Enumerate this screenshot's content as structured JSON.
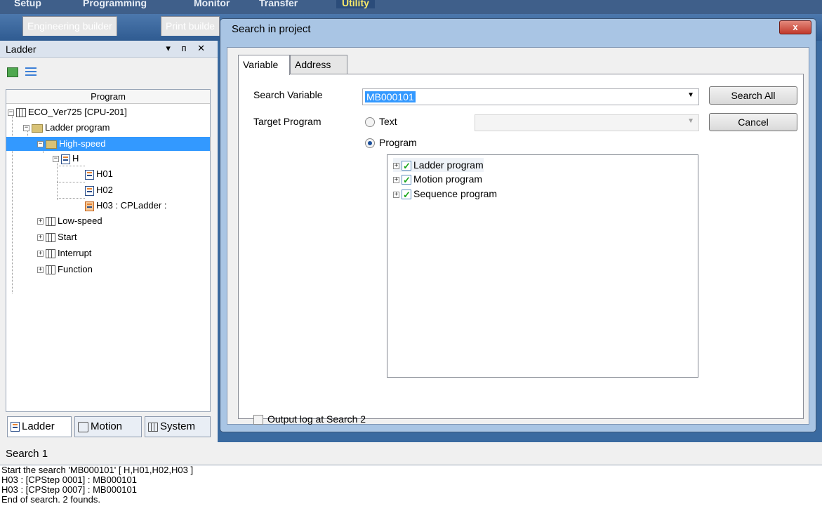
{
  "menu": {
    "items": [
      "Setup",
      "Programming",
      "Monitor",
      "Transfer",
      "Utility"
    ]
  },
  "doc_tabs": [
    "Engineering builder",
    "Print builde"
  ],
  "ladder_pane": {
    "title": "Ladder",
    "controls": "▾ ᴨ ✕",
    "tree_header": "Program",
    "tree": {
      "root": "ECO_Ver725 [CPU-201]",
      "ladder_program": "Ladder program",
      "high_speed": "High-speed",
      "h": "H",
      "h01": "H01",
      "h02": "H02",
      "h03": "H03 : CPLadder :",
      "low_speed": "Low-speed",
      "start": "Start",
      "interrupt": "Interrupt",
      "function": "Function"
    },
    "bottom_tabs": [
      "Ladder",
      "Motion",
      "System"
    ]
  },
  "dialog": {
    "title": "Search in project",
    "close_label": "x",
    "tabs": [
      "Variable",
      "Address"
    ],
    "search_variable_label": "Search Variable",
    "search_variable_value": "MB000101",
    "target_program_label": "Target Program",
    "radio_text_label": "Text",
    "radio_program_label": "Program",
    "program_tree": [
      "Ladder program",
      "Motion program",
      "Sequence program"
    ],
    "search_all_label": "Search All",
    "cancel_label": "Cancel",
    "output_log_label": "Output log at Search 2"
  },
  "search_panel": {
    "title": "Search 1",
    "log_lines": [
      "Start the search 'MB000101' [ H,H01,H02,H03 ]",
      "H03 : [CPStep 0001] : MB000101",
      "H03 : [CPStep 0007] : MB000101",
      "End of search. 2 founds."
    ]
  }
}
